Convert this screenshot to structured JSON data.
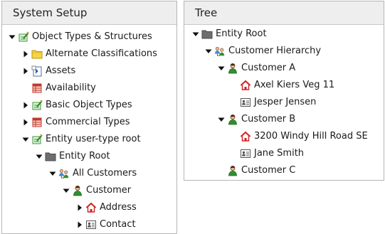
{
  "left_panel": {
    "title": "System Setup",
    "items": [
      {
        "label": "Object Types & Structures",
        "toggle": "expanded",
        "icon": "object-types-icon",
        "level": 0
      },
      {
        "label": "Alternate Classifications",
        "toggle": "collapsed",
        "icon": "folder-icon",
        "level": 1
      },
      {
        "label": "Assets",
        "toggle": "collapsed",
        "icon": "assets-icon",
        "level": 1
      },
      {
        "label": "Availability",
        "toggle": "none",
        "icon": "availability-icon",
        "level": 1
      },
      {
        "label": "Basic Object Types",
        "toggle": "collapsed",
        "icon": "object-types-icon",
        "level": 1
      },
      {
        "label": "Commercial Types",
        "toggle": "collapsed",
        "icon": "availability-icon",
        "level": 1
      },
      {
        "label": "Entity user-type root",
        "toggle": "expanded",
        "icon": "object-types-icon",
        "level": 1
      },
      {
        "label": "Entity Root",
        "toggle": "expanded",
        "icon": "folder-dark-icon",
        "level": 2
      },
      {
        "label": "All Customers",
        "toggle": "expanded",
        "icon": "hierarchy-icon",
        "level": 3
      },
      {
        "label": "Customer",
        "toggle": "expanded",
        "icon": "person-icon",
        "level": 4
      },
      {
        "label": "Address",
        "toggle": "collapsed",
        "icon": "house-icon",
        "level": 5
      },
      {
        "label": "Contact",
        "toggle": "collapsed",
        "icon": "contact-card-icon",
        "level": 5
      }
    ]
  },
  "right_panel": {
    "title": "Tree",
    "items": [
      {
        "label": "Entity Root",
        "toggle": "expanded",
        "icon": "folder-dark-icon",
        "level": 0
      },
      {
        "label": "Customer Hierarchy",
        "toggle": "expanded",
        "icon": "hierarchy-icon",
        "level": 1
      },
      {
        "label": "Customer A",
        "toggle": "expanded",
        "icon": "person-icon",
        "level": 2
      },
      {
        "label": "Axel Kiers Veg 11",
        "toggle": "none",
        "icon": "house-icon",
        "level": 3
      },
      {
        "label": "Jesper Jensen",
        "toggle": "none",
        "icon": "contact-card-icon",
        "level": 3
      },
      {
        "label": "Customer B",
        "toggle": "expanded",
        "icon": "person-icon",
        "level": 2
      },
      {
        "label": "3200 Windy Hill Road SE",
        "toggle": "none",
        "icon": "house-icon",
        "level": 3
      },
      {
        "label": "Jane Smith",
        "toggle": "none",
        "icon": "contact-card-icon",
        "level": 3
      },
      {
        "label": "Customer C",
        "toggle": "none",
        "icon": "person-icon",
        "level": 2
      }
    ]
  },
  "colors": {
    "header_bg": "#eeeeee",
    "border": "#b6b6b6",
    "folder_yellow": "#f5d547",
    "folder_dark": "#707070",
    "person_green": "#2f8f2f",
    "house_red": "#d42020",
    "table_red": "#c0392b"
  }
}
